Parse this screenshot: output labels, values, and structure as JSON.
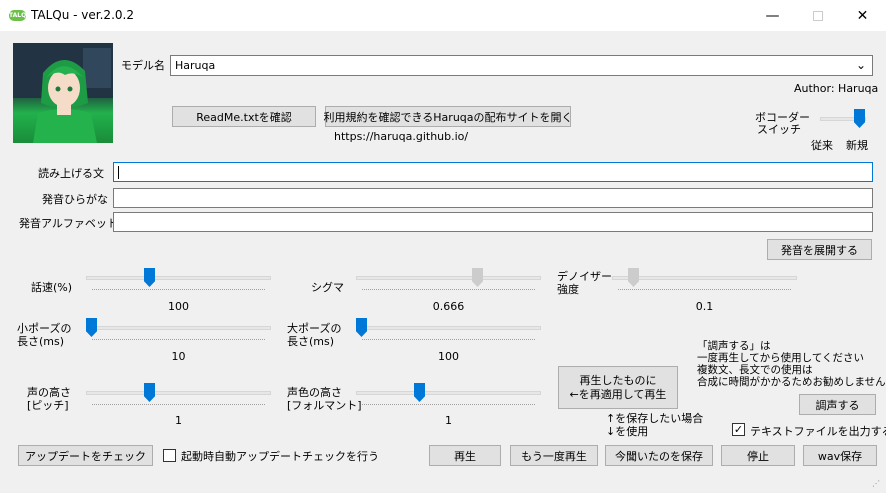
{
  "window": {
    "title": "TALQu - ver.2.0.2",
    "icon_text": "TALQu"
  },
  "header": {
    "model_label": "モデル名",
    "model_value": "Haruqa",
    "author": "Author: Haruqa",
    "readme_button": "ReadMe.txtを確認",
    "license_button": "利用規約を確認できるHaruqaの配布サイトを開く",
    "site_url": "https://haruqa.github.io/"
  },
  "vocoder": {
    "label_line1": "ボコーダー",
    "label_line2": "スイッチ",
    "left": "従来",
    "right": "新規",
    "value": "新規"
  },
  "text_fields": {
    "read_label": "読み上げる文",
    "hiragana_label": "発音ひらがな",
    "alphabet_label": "発音アルファベット",
    "read_value": "",
    "hiragana_value": "",
    "alphabet_value": "",
    "expand_button": "発音を展開する"
  },
  "sliders": {
    "speed": {
      "label": "話速(%)",
      "value": "100",
      "position": 0.34
    },
    "sigma": {
      "label": "シグマ",
      "value": "0.666",
      "position": 0.67
    },
    "denoiser": {
      "label1": "デノイザー",
      "label2": "強度",
      "value": "0.1",
      "position": 0.08
    },
    "small_pause": {
      "label1": "小ポーズの",
      "label2": "長さ(ms)",
      "value": "10",
      "position": 0.0
    },
    "large_pause": {
      "label1": "大ポーズの",
      "label2": "長さ(ms)",
      "value": "100",
      "position": 0.0
    },
    "pitch": {
      "label1": "声の高さ",
      "label2": "[ピッチ]",
      "value": "1",
      "position": 0.34
    },
    "formant": {
      "label1": "声色の高さ",
      "label2": "[フォルマント]",
      "value": "1",
      "position": 0.34
    }
  },
  "reapply_button": {
    "line1": "再生したものに",
    "line2": "←を再適用して再生"
  },
  "tune_note": {
    "line1": "「調声する」は",
    "line2": "一度再生してから使用してください",
    "line3": "複数文、長文での使用は",
    "line4": "合成に時間がかかるためお勧めしません"
  },
  "tune_button": "調声する",
  "save_hint": {
    "line1": "↑を保存したい場合",
    "line2": "↓を使用"
  },
  "text_file_checkbox": {
    "label": "テキストファイルを出力する",
    "checked": "✓"
  },
  "bottom": {
    "update_button": "アップデートをチェック",
    "auto_update_label": "起動時自動アップデートチェックを行う",
    "play": "再生",
    "replay": "もう一度再生",
    "save_last": "今聞いたのを保存",
    "stop": "停止",
    "wav_save": "wav保存"
  }
}
